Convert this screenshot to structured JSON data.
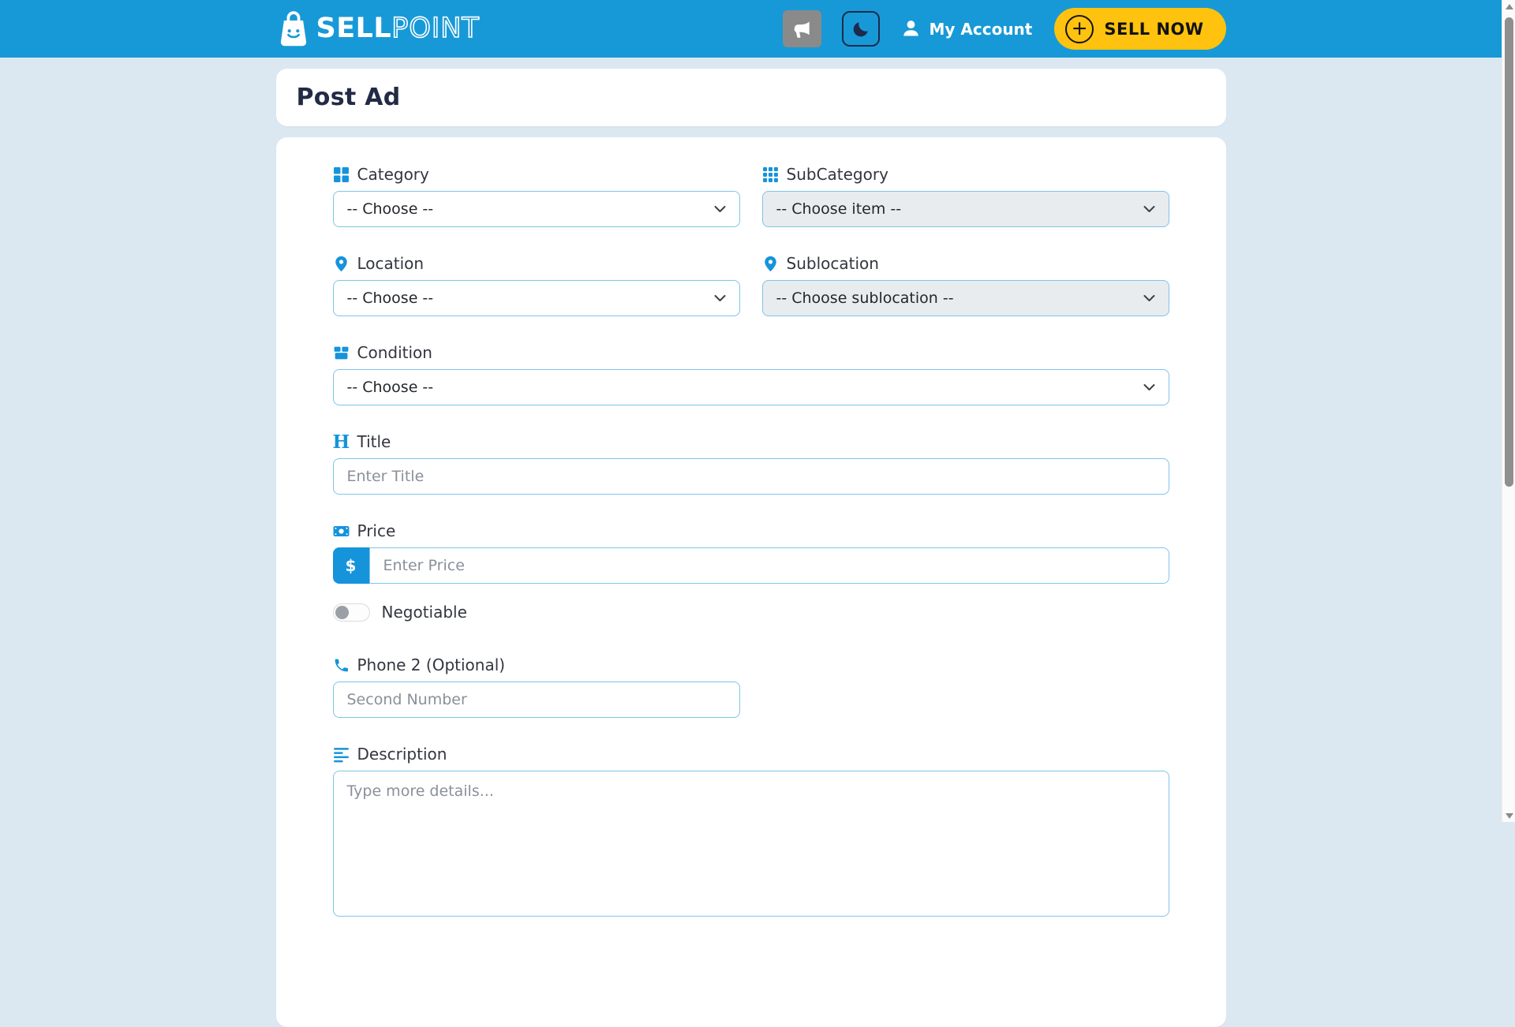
{
  "header": {
    "logo_bold": "SELL",
    "logo_light": "POINT",
    "my_account_label": "My Account",
    "sell_now_label": "SELL NOW",
    "plus_glyph": "+"
  },
  "page": {
    "title": "Post Ad"
  },
  "form": {
    "category": {
      "label": "Category",
      "value": "-- Choose --",
      "disabled": false
    },
    "subcategory": {
      "label": "SubCategory",
      "value": "-- Choose item --",
      "disabled": true
    },
    "location": {
      "label": "Location",
      "value": "-- Choose --",
      "disabled": false
    },
    "sublocation": {
      "label": "Sublocation",
      "value": "-- Choose sublocation --",
      "disabled": true
    },
    "condition": {
      "label": "Condition",
      "value": "-- Choose --",
      "disabled": false
    },
    "title": {
      "label": "Title",
      "placeholder": "Enter Title",
      "value": ""
    },
    "price": {
      "label": "Price",
      "prefix": "$",
      "placeholder": "Enter Price",
      "value": ""
    },
    "negotiable": {
      "label": "Negotiable",
      "checked": false
    },
    "phone2": {
      "label": "Phone 2 (Optional)",
      "placeholder": "Second Number",
      "value": ""
    },
    "description": {
      "label": "Description",
      "placeholder": "Type more details...",
      "value": ""
    }
  },
  "icons": [
    "shopping-bag-logo-icon",
    "megaphone-icon",
    "moon-icon",
    "person-icon",
    "plus-circle-icon",
    "grid-2x2-icon",
    "grid-3x3-icon",
    "map-pin-icon",
    "box-icon",
    "heading-icon",
    "money-bill-icon",
    "phone-icon",
    "align-left-icon",
    "chevron-down-icon"
  ],
  "colors": {
    "header_bg": "#1799D7",
    "page_bg": "#DBE8F1",
    "accent_blue": "#1593DB",
    "field_border": "#7EC4EA",
    "disabled_bg": "#E9ECEF",
    "sell_now_yellow": "#FFC20E",
    "title_text": "#232A45",
    "label_text": "#33363F",
    "placeholder_text": "#8A9099"
  }
}
